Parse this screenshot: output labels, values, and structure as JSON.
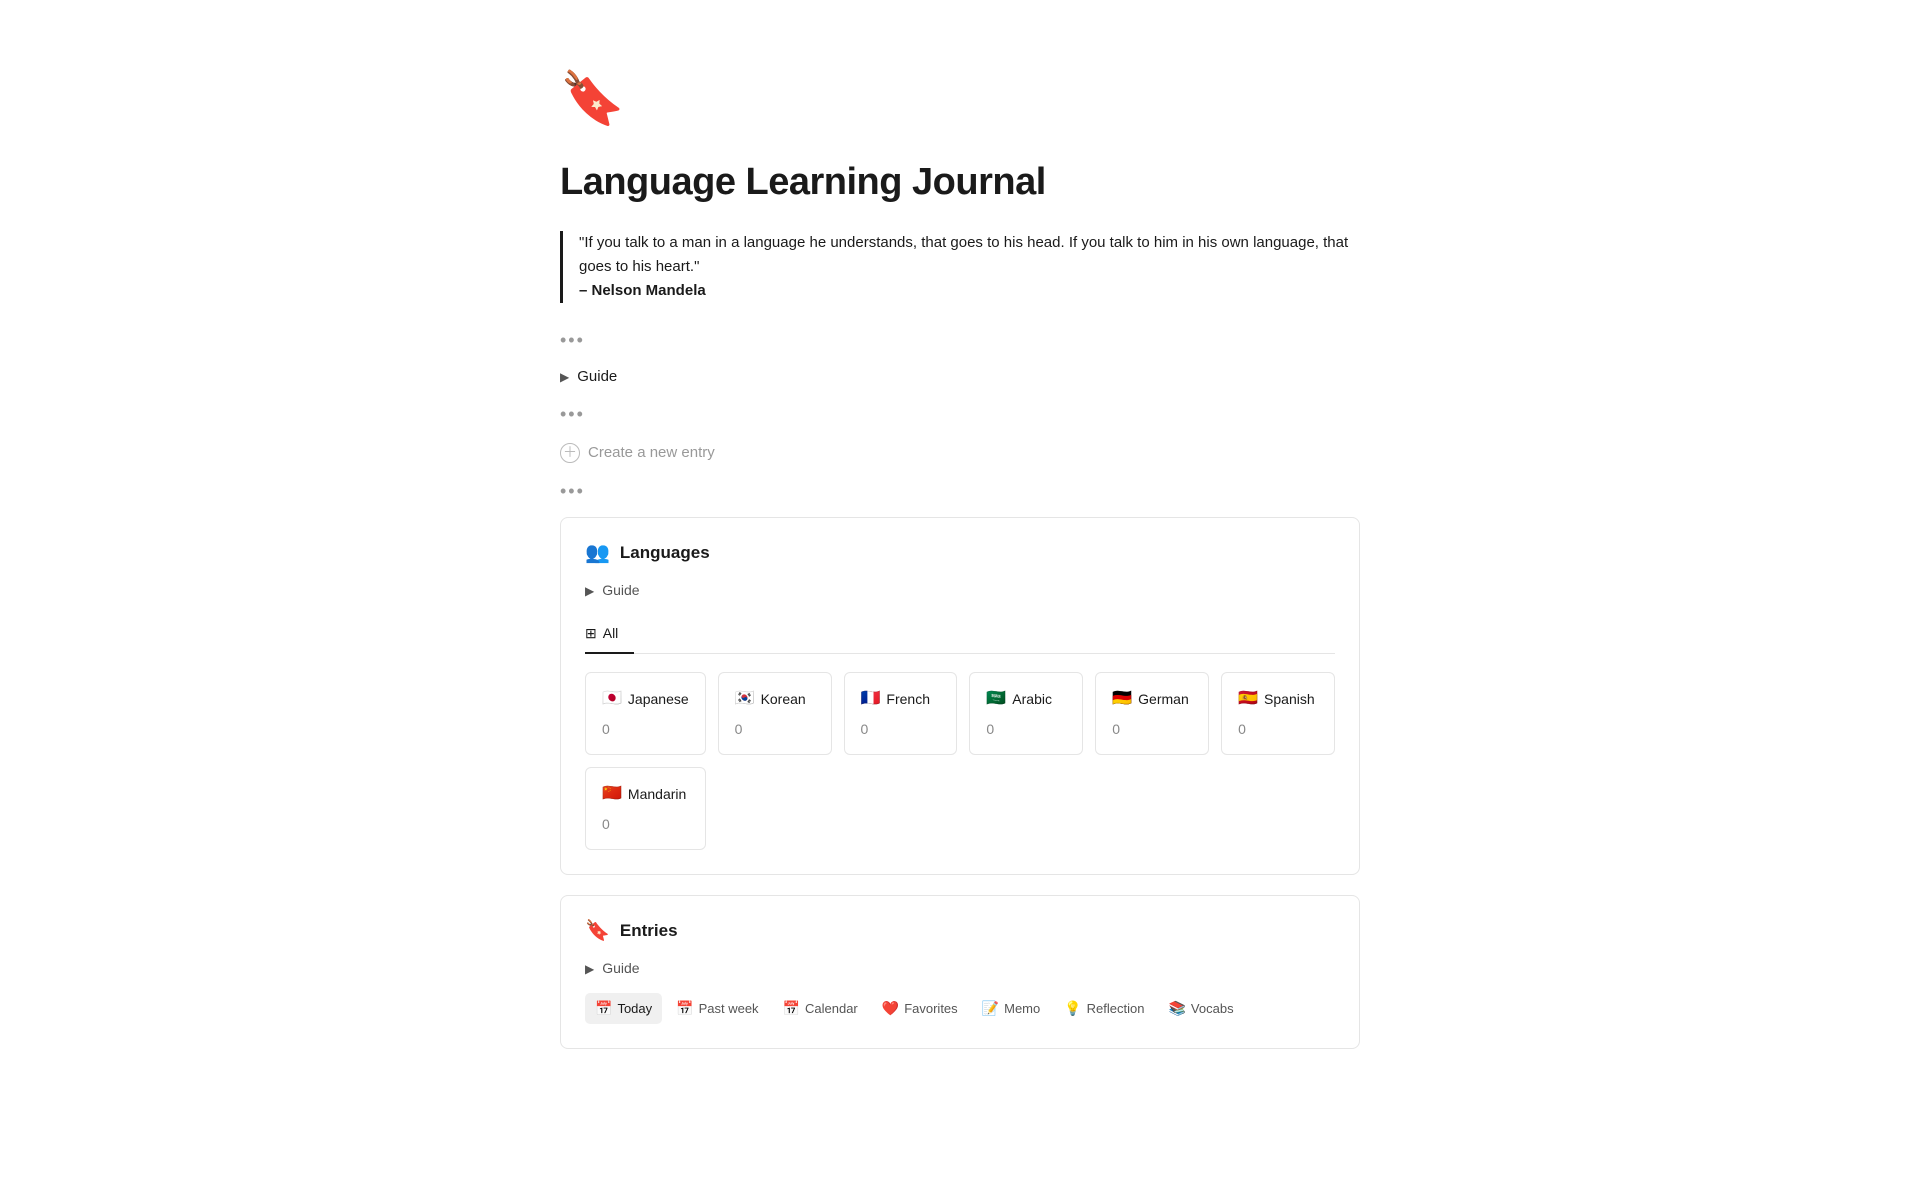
{
  "page": {
    "icon": "🔖",
    "title": "Language Learning Journal",
    "quote": {
      "text": "\"If you talk to a man in a language he understands, that goes to his head. If you talk to him in his own language, that goes to his heart.\"",
      "author": "– Nelson Mandela"
    },
    "dots1": "•••",
    "guide_toggle": "Guide",
    "dots2": "•••",
    "create_entry_label": "Create a new entry",
    "dots3": "•••"
  },
  "languages_section": {
    "icon": "👥",
    "title": "Languages",
    "guide_label": "Guide",
    "tab_all_label": "All",
    "languages": [
      {
        "flag": "🇯🇵",
        "name": "Japanese",
        "count": "0"
      },
      {
        "flag": "🇰🇷",
        "name": "Korean",
        "count": "0"
      },
      {
        "flag": "🇫🇷",
        "name": "French",
        "count": "0"
      },
      {
        "flag": "🇸🇦",
        "name": "Arabic",
        "count": "0"
      },
      {
        "flag": "🇩🇪",
        "name": "German",
        "count": "0"
      },
      {
        "flag": "🇪🇸",
        "name": "Spanish",
        "count": "0"
      },
      {
        "flag": "🇨🇳",
        "name": "Mandarin",
        "count": "0"
      }
    ]
  },
  "entries_section": {
    "icon": "🔖",
    "title": "Entries",
    "guide_label": "Guide",
    "tabs": [
      {
        "icon": "📅",
        "label": "Today",
        "active": true
      },
      {
        "icon": "📅",
        "label": "Past week",
        "active": false
      },
      {
        "icon": "📅",
        "label": "Calendar",
        "active": false
      },
      {
        "icon": "❤️",
        "label": "Favorites",
        "active": false
      },
      {
        "icon": "📝",
        "label": "Memo",
        "active": false
      },
      {
        "icon": "💡",
        "label": "Reflection",
        "active": false
      },
      {
        "icon": "📚",
        "label": "Vocabs",
        "active": false
      }
    ]
  }
}
